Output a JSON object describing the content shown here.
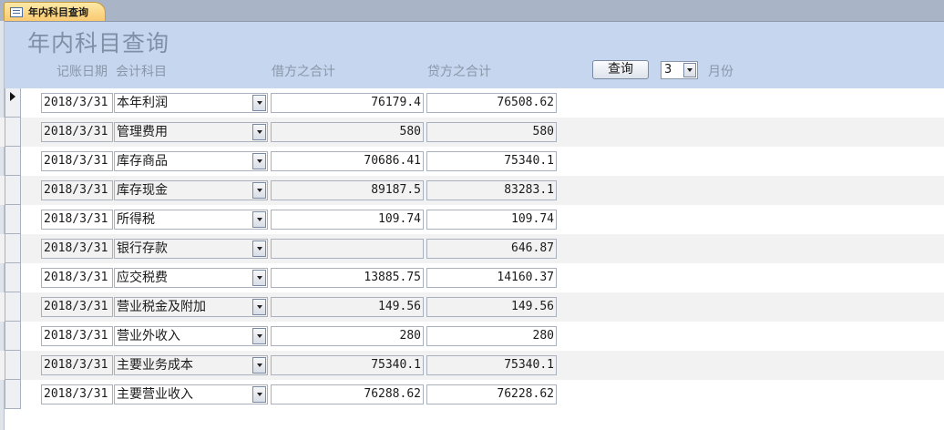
{
  "tab": {
    "label": "年内科目查询"
  },
  "form": {
    "title": "年内科目查询",
    "labels": {
      "date": "记账日期",
      "subject": "会计科目",
      "debit": "借方之合计",
      "credit": "贷方之合计"
    },
    "query_button": "查询",
    "month_value": "3",
    "month_suffix": "月份"
  },
  "rows": [
    {
      "date": "2018/3/31",
      "subject": "本年利润",
      "debit": "76179.4",
      "credit": "76508.62"
    },
    {
      "date": "2018/3/31",
      "subject": "管理费用",
      "debit": "580",
      "credit": "580"
    },
    {
      "date": "2018/3/31",
      "subject": "库存商品",
      "debit": "70686.41",
      "credit": "75340.1"
    },
    {
      "date": "2018/3/31",
      "subject": "库存现金",
      "debit": "89187.5",
      "credit": "83283.1"
    },
    {
      "date": "2018/3/31",
      "subject": "所得税",
      "debit": "109.74",
      "credit": "109.74"
    },
    {
      "date": "2018/3/31",
      "subject": "银行存款",
      "debit": "",
      "credit": "646.87"
    },
    {
      "date": "2018/3/31",
      "subject": "应交税费",
      "debit": "13885.75",
      "credit": "14160.37"
    },
    {
      "date": "2018/3/31",
      "subject": "营业税金及附加",
      "debit": "149.56",
      "credit": "149.56"
    },
    {
      "date": "2018/3/31",
      "subject": "营业外收入",
      "debit": "280",
      "credit": "280"
    },
    {
      "date": "2018/3/31",
      "subject": "主要业务成本",
      "debit": "75340.1",
      "credit": "75340.1"
    },
    {
      "date": "2018/3/31",
      "subject": "主要营业收入",
      "debit": "76288.62",
      "credit": "76228.62"
    }
  ]
}
